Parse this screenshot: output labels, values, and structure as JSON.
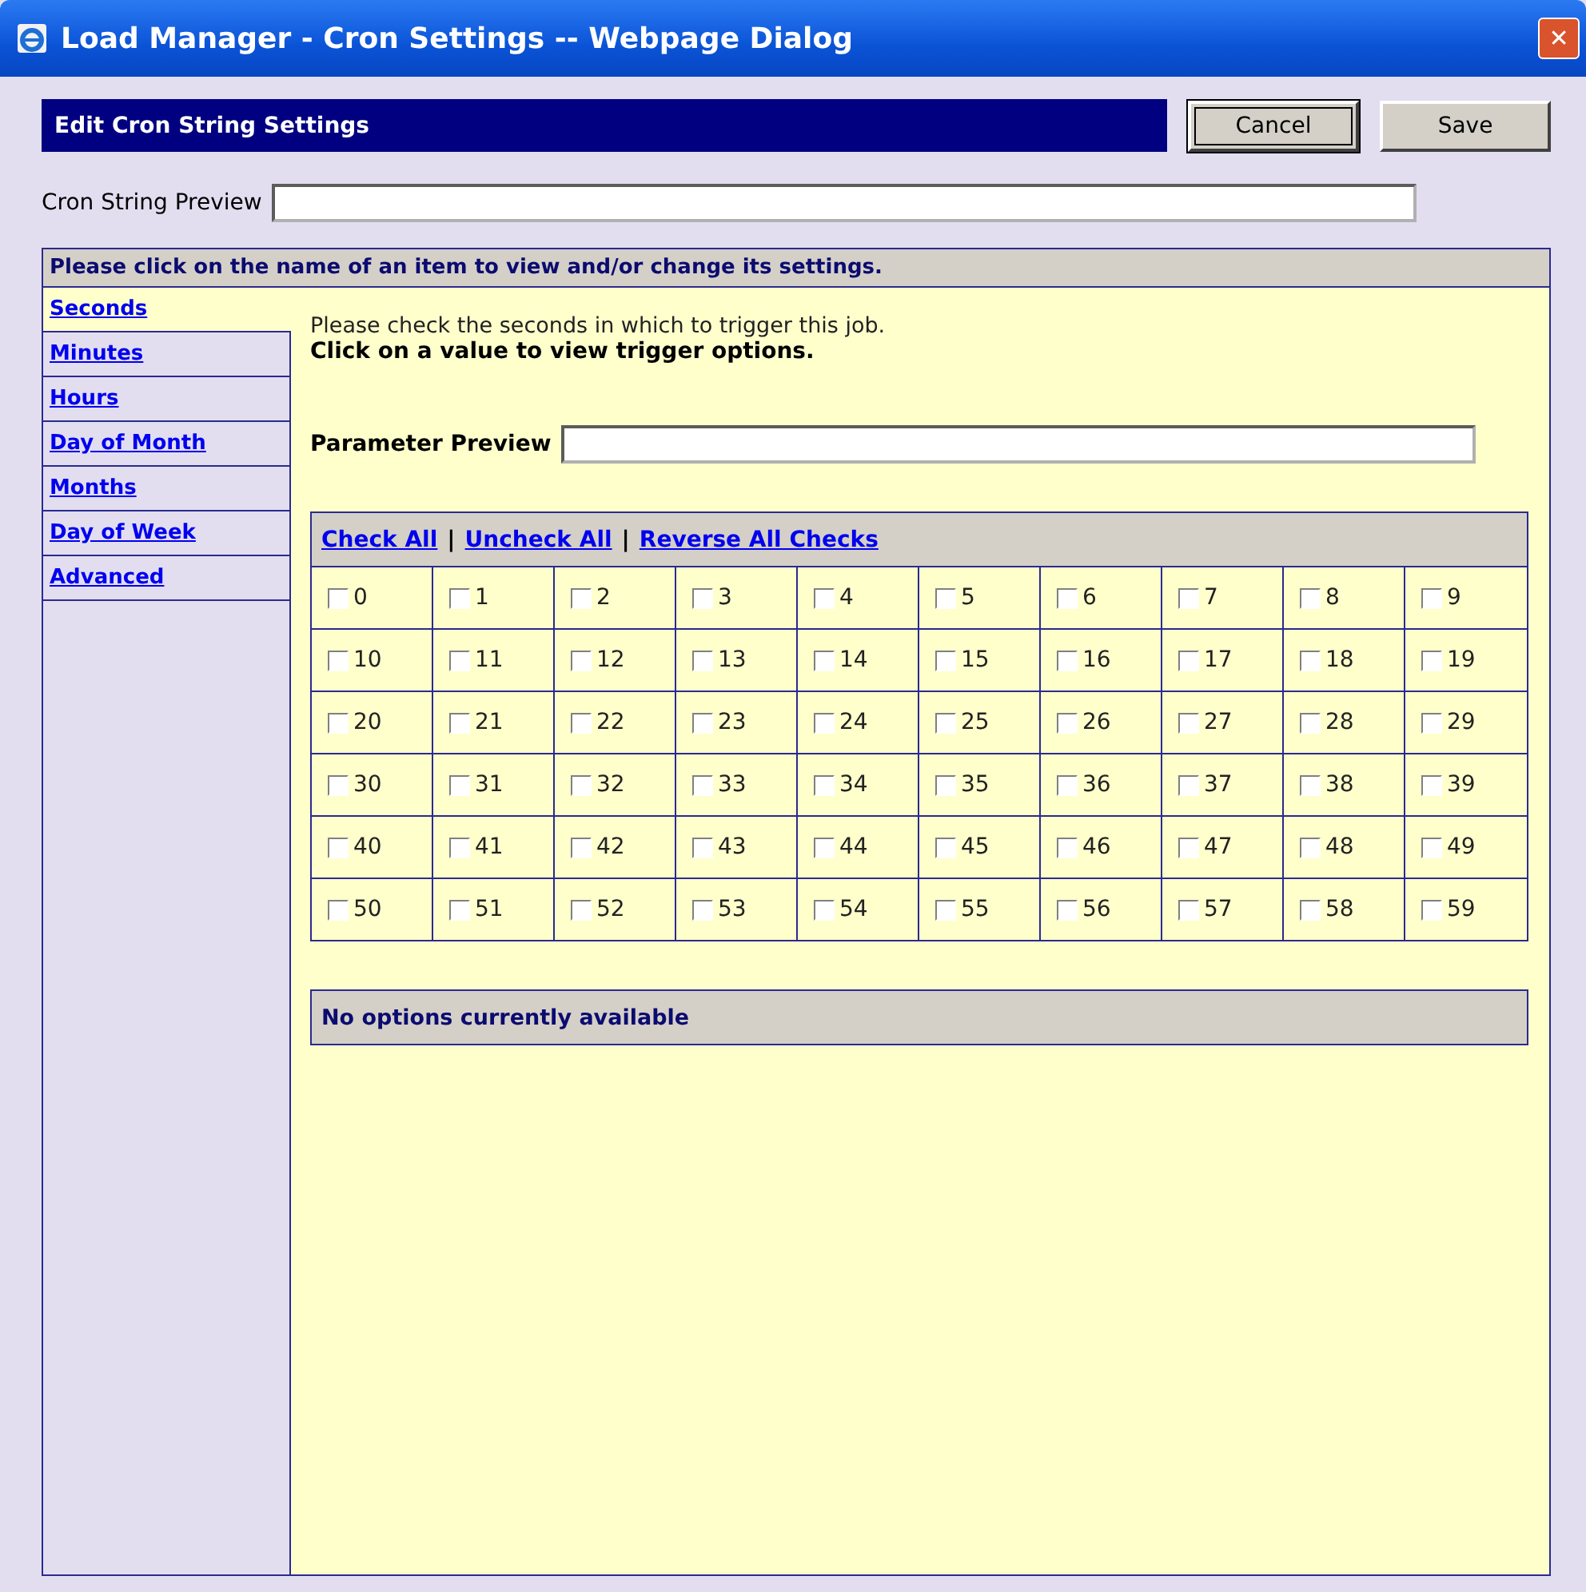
{
  "window": {
    "title": "Load Manager - Cron Settings -- Webpage Dialog",
    "close": "✕"
  },
  "header": {
    "title": "Edit Cron String Settings",
    "buttons": [
      {
        "label": "Cancel",
        "focused": true
      },
      {
        "label": "Save",
        "focused": false
      }
    ]
  },
  "cron_preview": {
    "label": "Cron String Preview"
  },
  "panel": {
    "instruction": "Please click on the name of an item to view and/or change its settings.",
    "sidebar": [
      {
        "label": "Seconds",
        "selected": true
      },
      {
        "label": "Minutes",
        "selected": false
      },
      {
        "label": "Hours",
        "selected": false
      },
      {
        "label": "Day of Month",
        "selected": false
      },
      {
        "label": "Months",
        "selected": false
      },
      {
        "label": "Day of Week",
        "selected": false
      },
      {
        "label": "Advanced",
        "selected": false
      }
    ],
    "description": "Please check the seconds in which to trigger this job.",
    "hint": "Click on a value to view trigger options.",
    "parameter_preview": {
      "label": "Parameter Preview"
    },
    "actions": [
      {
        "kind": "link",
        "text": "Check All"
      },
      {
        "kind": "separator",
        "text": "|"
      },
      {
        "kind": "link",
        "text": "Uncheck All"
      },
      {
        "kind": "separator",
        "text": "|"
      },
      {
        "kind": "link",
        "text": "Reverse All Checks"
      }
    ],
    "values": [
      {
        "label": "0",
        "checked": false
      },
      {
        "label": "1",
        "checked": false
      },
      {
        "label": "2",
        "checked": false
      },
      {
        "label": "3",
        "checked": false
      },
      {
        "label": "4",
        "checked": false
      },
      {
        "label": "5",
        "checked": false
      },
      {
        "label": "6",
        "checked": false
      },
      {
        "label": "7",
        "checked": false
      },
      {
        "label": "8",
        "checked": false
      },
      {
        "label": "9",
        "checked": false
      },
      {
        "label": "10",
        "checked": false
      },
      {
        "label": "11",
        "checked": false
      },
      {
        "label": "12",
        "checked": false
      },
      {
        "label": "13",
        "checked": false
      },
      {
        "label": "14",
        "checked": false
      },
      {
        "label": "15",
        "checked": false
      },
      {
        "label": "16",
        "checked": false
      },
      {
        "label": "17",
        "checked": false
      },
      {
        "label": "18",
        "checked": false
      },
      {
        "label": "19",
        "checked": false
      },
      {
        "label": "20",
        "checked": false
      },
      {
        "label": "21",
        "checked": false
      },
      {
        "label": "22",
        "checked": false
      },
      {
        "label": "23",
        "checked": false
      },
      {
        "label": "24",
        "checked": false
      },
      {
        "label": "25",
        "checked": false
      },
      {
        "label": "26",
        "checked": false
      },
      {
        "label": "27",
        "checked": false
      },
      {
        "label": "28",
        "checked": false
      },
      {
        "label": "29",
        "checked": false
      },
      {
        "label": "30",
        "checked": false
      },
      {
        "label": "31",
        "checked": false
      },
      {
        "label": "32",
        "checked": false
      },
      {
        "label": "33",
        "checked": false
      },
      {
        "label": "34",
        "checked": false
      },
      {
        "label": "35",
        "checked": false
      },
      {
        "label": "36",
        "checked": false
      },
      {
        "label": "37",
        "checked": false
      },
      {
        "label": "38",
        "checked": false
      },
      {
        "label": "39",
        "checked": false
      },
      {
        "label": "40",
        "checked": false
      },
      {
        "label": "41",
        "checked": false
      },
      {
        "label": "42",
        "checked": false
      },
      {
        "label": "43",
        "checked": false
      },
      {
        "label": "44",
        "checked": false
      },
      {
        "label": "45",
        "checked": false
      },
      {
        "label": "46",
        "checked": false
      },
      {
        "label": "47",
        "checked": false
      },
      {
        "label": "48",
        "checked": false
      },
      {
        "label": "49",
        "checked": false
      },
      {
        "label": "50",
        "checked": false
      },
      {
        "label": "51",
        "checked": false
      },
      {
        "label": "52",
        "checked": false
      },
      {
        "label": "53",
        "checked": false
      },
      {
        "label": "54",
        "checked": false
      },
      {
        "label": "55",
        "checked": false
      },
      {
        "label": "56",
        "checked": false
      },
      {
        "label": "57",
        "checked": false
      },
      {
        "label": "58",
        "checked": false
      },
      {
        "label": "59",
        "checked": false
      }
    ],
    "options_message": "No options currently available"
  }
}
